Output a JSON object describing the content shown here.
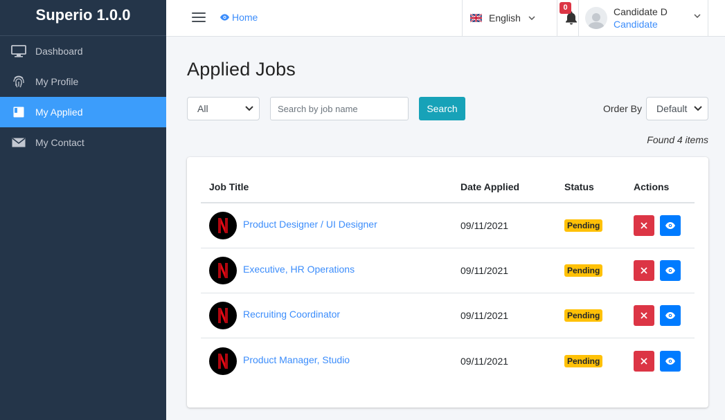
{
  "sidebar": {
    "brand": "Superio 1.0.0",
    "items": [
      {
        "label": "Dashboard",
        "icon": "monitor-icon",
        "active": false
      },
      {
        "label": "My Profile",
        "icon": "fingerprint-icon",
        "active": false
      },
      {
        "label": "My Applied",
        "icon": "book-icon",
        "active": true
      },
      {
        "label": "My Contact",
        "icon": "envelope-icon",
        "active": false
      }
    ]
  },
  "topbar": {
    "home_label": "Home",
    "language": "English",
    "notification_count": "0",
    "user_name": "Candidate D",
    "user_role": "Candidate"
  },
  "main": {
    "title": "Applied Jobs",
    "filter_value": "All",
    "search_placeholder": "Search by job name",
    "search_button": "Search",
    "order_label": "Order By",
    "order_value": "Default",
    "found_text": "Found 4 items"
  },
  "table": {
    "headers": {
      "title": "Job Title",
      "date": "Date Applied",
      "status": "Status",
      "actions": "Actions"
    },
    "rows": [
      {
        "title": "Product Designer / UI Designer",
        "date": "09/11/2021",
        "status": "Pending"
      },
      {
        "title": "Executive, HR Operations",
        "date": "09/11/2021",
        "status": "Pending"
      },
      {
        "title": "Recruiting Coordinator",
        "date": "09/11/2021",
        "status": "Pending"
      },
      {
        "title": "Product Manager, Studio",
        "date": "09/11/2021",
        "status": "Pending"
      }
    ]
  },
  "colors": {
    "sidebar_bg": "#243549",
    "active_nav": "#3c9dfb",
    "link": "#3c8dfb",
    "search_button": "#17a2b8",
    "pending_badge": "#ffc107",
    "delete_button": "#dc3545",
    "view_button": "#007bff"
  }
}
